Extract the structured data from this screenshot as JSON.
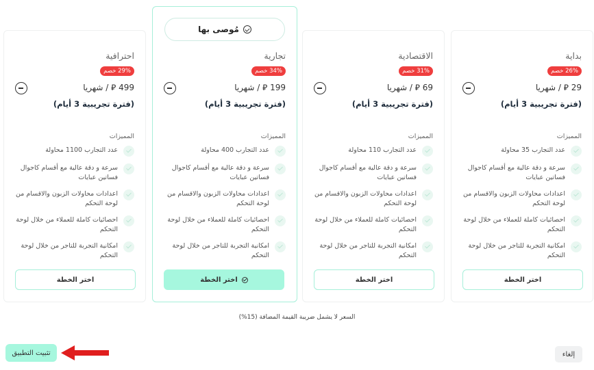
{
  "plans": [
    {
      "name": "احترافية",
      "discount": "29% خصم",
      "price": "499 ⃁ / شهريا",
      "trial": "(فترة تجريبية 3 أيام)",
      "features_title": "المميزات",
      "features": [
        "عدد التجارب 1100 محاولة",
        "سرعة و دقة عالية مع أقسام كاجوال فساتين عبايات",
        "اعدادات محاولات الزبون والاقسام من لوحة التحكم",
        "احصائيات كاملة للعملاء من خلال لوحة التحكم",
        "امكانية التجربة للتاجر من خلال لوحة التحكم"
      ],
      "cta": "اختر الخطة",
      "featured": false
    },
    {
      "name": "تجارية",
      "recommended_label": "مُوصى بها",
      "discount": "34% خصم",
      "price": "199 ⃁ / شهريا",
      "trial": "(فترة تجريبية 3 أيام)",
      "features_title": "المميزات",
      "features": [
        "عدد التجارب 400 محاولة",
        "سرعة و دقة عالية مع أقسام كاجوال فساتين عبايات",
        "اعدادات محاولات الزبون والاقسام من لوحة التحكم",
        "احصائيات كاملة للعملاء من خلال لوحة التحكم",
        "امكانية التجربة للتاجر من خلال لوحة التحكم"
      ],
      "cta": "اختر الخطة",
      "featured": true
    },
    {
      "name": "الاقتصادية",
      "discount": "31% خصم",
      "price": "69 ⃁ / شهريا",
      "trial": "(فترة تجريبية 3 أيام)",
      "features_title": "المميزات",
      "features": [
        "عدد التجارب 110 محاولة",
        "سرعة و دقة عالية مع أقسام كاجوال فساتين عبايات",
        "اعدادات محاولات الزبون والاقسام من لوحة التحكم",
        "احصائيات كاملة للعملاء من خلال لوحة التحكم",
        "امكانية التجربة للتاجر من خلال لوحة التحكم"
      ],
      "cta": "اختر الخطة",
      "featured": false
    },
    {
      "name": "بداية",
      "discount": "26% خصم",
      "price": "29 ⃁ / شهريا",
      "trial": "(فترة تجريبية 3 أيام)",
      "features_title": "المميزات",
      "features": [
        "عدد التجارب 35 محاولة",
        "سرعة و دقة عالية مع أقسام كاجوال فساتين عبايات",
        "اعدادات محاولات الزبون والاقسام من لوحة التحكم",
        "احصائيات كاملة للعملاء من خلال لوحة التحكم",
        "امكانية التجربة للتاجر من خلال لوحة التحكم"
      ],
      "cta": "اختر الخطة",
      "featured": false
    }
  ],
  "vat_note": "السعر لا يشمل ضريبة القيمة المضافة (15%)",
  "footer": {
    "install_label": "تثبيت التطبيق",
    "cancel_label": "إلغاء"
  },
  "colors": {
    "accent": "#a6f7de",
    "discount_badge": "#ef3e3e",
    "annotation_arrow": "#e01e1e"
  }
}
